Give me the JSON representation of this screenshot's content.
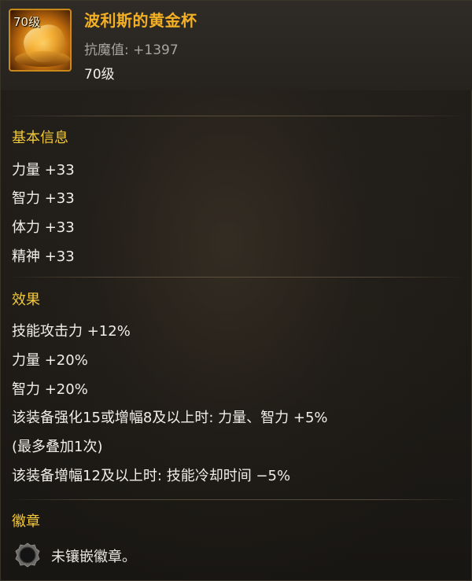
{
  "item": {
    "icon_level": "70级",
    "name": "波利斯的黄金杯",
    "stat": "抗魔值: +1397",
    "level": "70级",
    "icon": "golden-cup-icon"
  },
  "sections": {
    "basic": {
      "title": "基本信息",
      "lines": [
        "力量 +33",
        "智力 +33",
        "体力 +33",
        "精神 +33"
      ]
    },
    "effects": {
      "title": "效果",
      "lines": [
        "技能攻击力 +12%",
        "力量 +20%",
        "智力 +20%",
        "该装备强化15或增幅8及以上时: 力量、智力 +5%",
        "(最多叠加1次)",
        "该装备增幅12及以上时: 技能冷却时间 −5%"
      ]
    },
    "emblem": {
      "title": "徽章",
      "slot_text": "未镶嵌徽章。",
      "slot_icon": "empty-emblem-slot-icon"
    }
  },
  "colors": {
    "item_name": "#f4b024",
    "section_title": "#f3c93a",
    "body_text": "#f1eee9",
    "stat_text": "#a8a49e"
  }
}
